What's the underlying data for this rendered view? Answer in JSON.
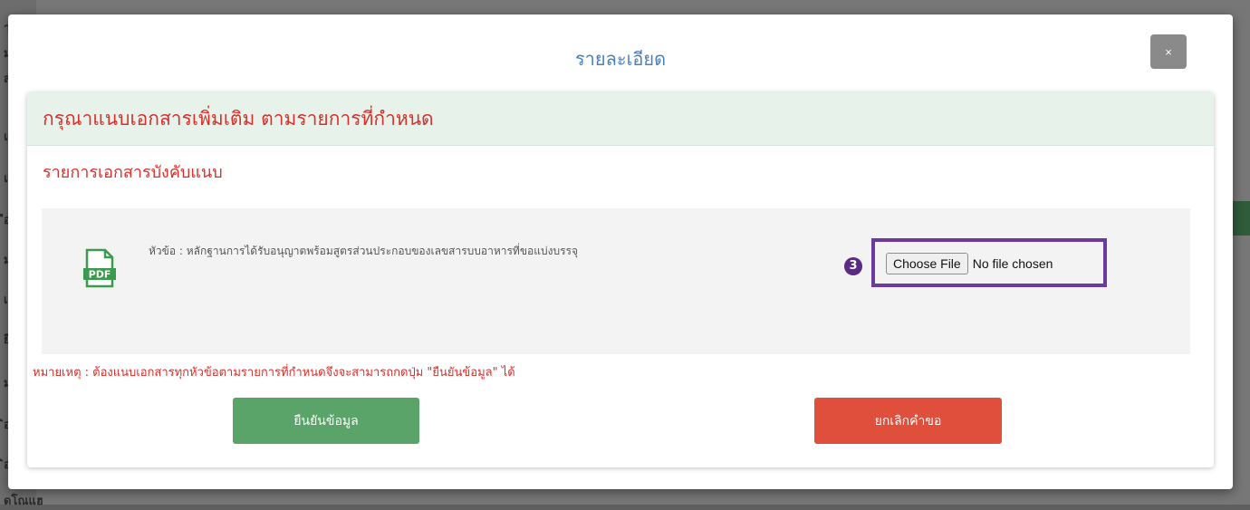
{
  "background": {
    "fragments": [
      "าอ",
      "ม",
      "ส",
      "แฟ",
      "แฟ",
      "ือ",
      "มบ",
      "เ",
      "ยี่",
      "ม",
      "ิอ",
      "ิอ",
      "ดโณแฮ"
    ]
  },
  "modal": {
    "title": "รายละเอียด",
    "close_label": "×",
    "card": {
      "header": "กรุณาแนบเอกสารเพิ่มเติม ตามรายการที่กำหนด",
      "section_title": "รายการเอกสารบังคับแนบ",
      "document": {
        "icon": "pdf-icon",
        "icon_text": "PDF",
        "title": "หัวข้อ : หลักฐานการได้รับอนุญาตพร้อมสูตรส่วนประกอบของเลขสารบบอาหารที่ขอแบ่งบรรจุ",
        "step_badge": "3",
        "choose_file_label": "Choose File",
        "no_file_text": "No file chosen"
      },
      "note": "หมายเหตุ : ต้องแนบเอกสารทุกหัวข้อตามรายการที่กำหนดจึงจะสามารถกดปุ่ม \"ยืนยันข้อมูล\" ได้",
      "confirm_label": "ยืนยันข้อมูล",
      "cancel_label": "ยกเลิกคำขอ"
    }
  },
  "colors": {
    "title_blue": "#4a7fc0",
    "header_red": "#d9302c",
    "header_bg": "#e7f3ea",
    "confirm_green": "#5aa469",
    "cancel_red": "#e04e3c",
    "highlight_purple": "#6a3aa0"
  }
}
